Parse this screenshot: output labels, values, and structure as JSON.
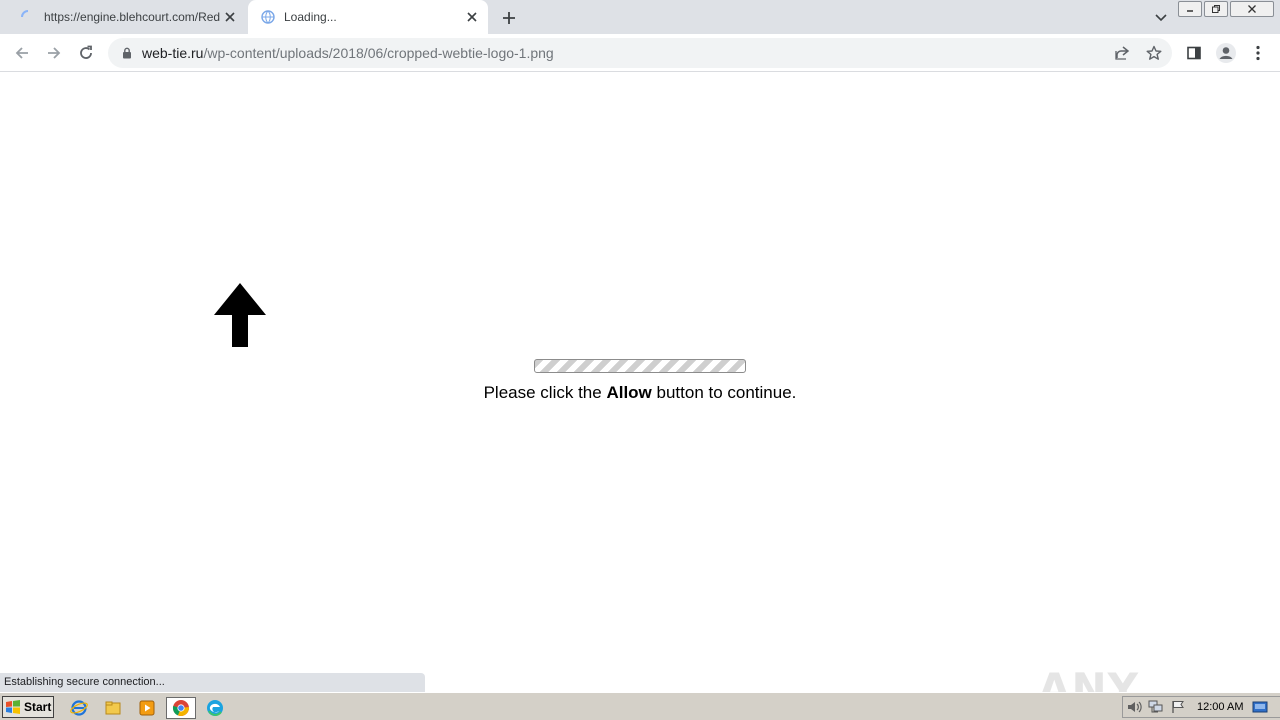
{
  "browser": {
    "tabs": [
      {
        "title": "https://engine.blehcourt.com/Redire",
        "active": false
      },
      {
        "title": "Loading...",
        "active": true
      }
    ],
    "address_bar": {
      "domain": "web-tie.ru",
      "path": "/wp-content/uploads/2018/06/cropped-webtie-logo-1.png"
    },
    "status_text": "Establishing secure connection..."
  },
  "page": {
    "message_before": "Please click the ",
    "message_bold": "Allow",
    "message_after": " button to continue."
  },
  "watermark": {
    "text": "ANY RUN"
  },
  "taskbar": {
    "start_label": "Start",
    "clock": "12:00 AM"
  },
  "colors": {
    "tabstrip": "#dee1e6",
    "omnibox": "#f1f3f4",
    "taskbar": "#d4d0c8",
    "progress_stripe": "#cfcfcf"
  }
}
